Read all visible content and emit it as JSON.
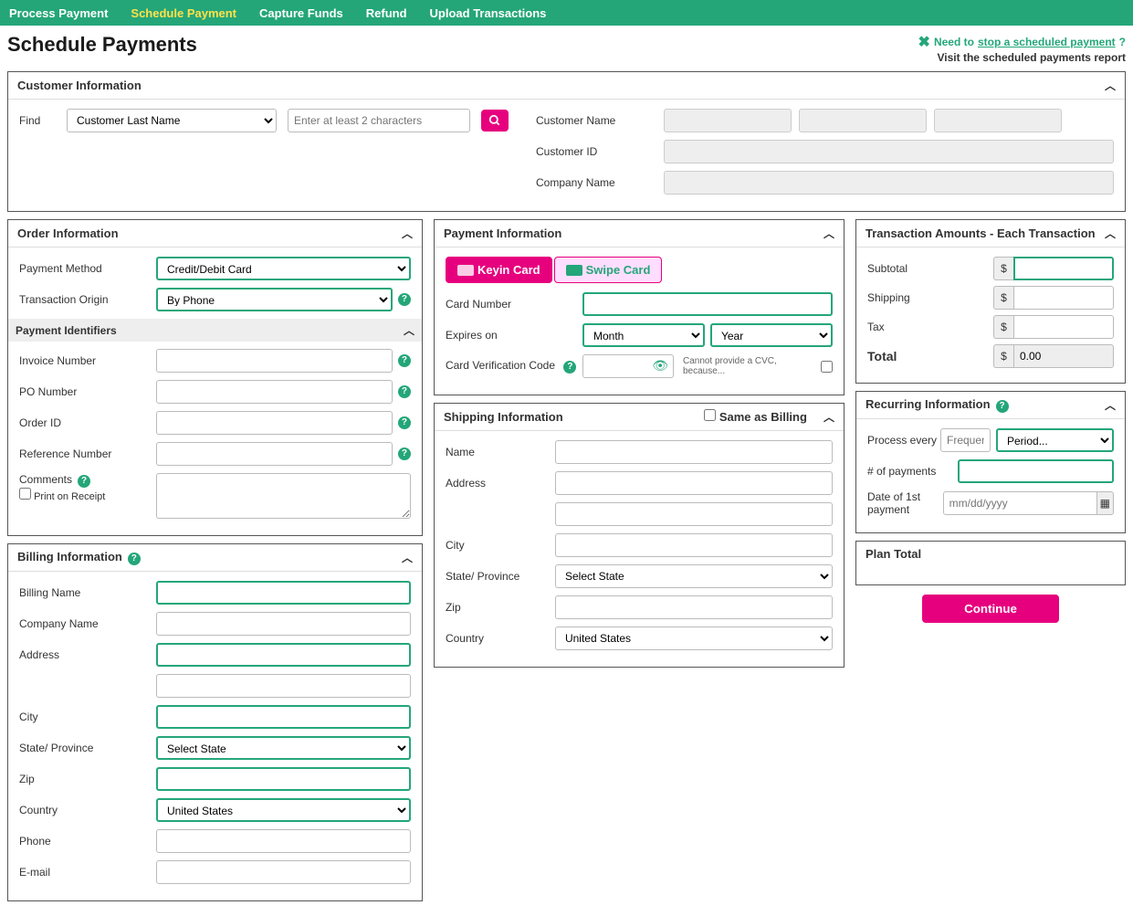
{
  "nav": {
    "items": [
      "Process Payment",
      "Schedule Payment",
      "Capture Funds",
      "Refund",
      "Upload Transactions"
    ],
    "active": "Schedule Payment"
  },
  "page": {
    "title": "Schedule Payments",
    "stop": {
      "need": "Need to",
      "link": "stop a scheduled payment",
      "q": "?",
      "sub": "Visit the scheduled payments report"
    }
  },
  "customer": {
    "title": "Customer Information",
    "find_label": "Find",
    "find_by": "Customer Last Name",
    "search_placeholder": "Enter at least 2 characters",
    "name_label": "Customer Name",
    "id_label": "Customer ID",
    "company_label": "Company Name"
  },
  "order": {
    "title": "Order Information",
    "payment_method_label": "Payment Method",
    "payment_method": "Credit/Debit Card",
    "origin_label": "Transaction Origin",
    "origin": "By Phone",
    "ids_title": "Payment Identifiers",
    "invoice_label": "Invoice Number",
    "po_label": "PO Number",
    "orderid_label": "Order ID",
    "ref_label": "Reference Number",
    "comments_label": "Comments",
    "print_label": "Print on Receipt"
  },
  "billing": {
    "title": "Billing Information",
    "name_label": "Billing Name",
    "company_label": "Company Name",
    "address_label": "Address",
    "city_label": "City",
    "state_label": "State/ Province",
    "state": "Select State",
    "zip_label": "Zip",
    "country_label": "Country",
    "country": "United States",
    "phone_label": "Phone",
    "email_label": "E-mail"
  },
  "payment": {
    "title": "Payment Information",
    "keyin": "Keyin Card",
    "swipe": "Swipe Card",
    "card_label": "Card Number",
    "exp_label": "Expires on",
    "month": "Month",
    "year": "Year",
    "cvc_label": "Card Verification Code",
    "cvc_hint": "Cannot provide a CVC, because..."
  },
  "shipping": {
    "title": "Shipping Information",
    "same_label": "Same as Billing",
    "name_label": "Name",
    "address_label": "Address",
    "city_label": "City",
    "state_label": "State/ Province",
    "state": "Select State",
    "zip_label": "Zip",
    "country_label": "Country",
    "country": "United States"
  },
  "amounts": {
    "title": "Transaction Amounts - Each Transaction",
    "subtotal_label": "Subtotal",
    "shipping_label": "Shipping",
    "tax_label": "Tax",
    "total_label": "Total",
    "total": "0.00",
    "currency": "$"
  },
  "recurring": {
    "title": "Recurring Information",
    "process_label": "Process every",
    "freq_placeholder": "Frequency",
    "period": "Period...",
    "payments_label": "# of payments",
    "date_label": "Date of 1st payment",
    "date_placeholder": "mm/dd/yyyy"
  },
  "plan": {
    "title": "Plan Total"
  },
  "continue": "Continue"
}
